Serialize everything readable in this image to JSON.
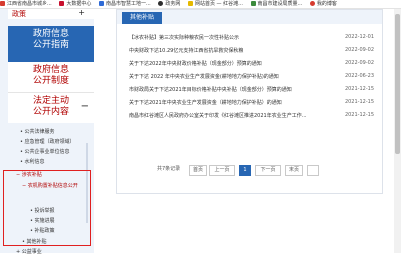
{
  "bookmarks": [
    {
      "label": "江西省南昌市城乡...",
      "icon": "favicon-icon"
    },
    {
      "label": "大数据中心",
      "icon": "favicon-icon"
    },
    {
      "label": "南昌市智慧工地一...",
      "icon": "favicon-icon"
    },
    {
      "label": "政务网",
      "icon": "favicon-icon"
    },
    {
      "label": "网站首页 — 红谷滩...",
      "icon": "favicon-icon"
    },
    {
      "label": "南昌市建设局质量...",
      "icon": "favicon-icon"
    },
    {
      "label": "我的博客",
      "icon": "favicon-icon"
    }
  ],
  "sidebar": {
    "top_item": "政策",
    "top_toggle": "+",
    "guide": [
      "政府信息",
      "公开指南"
    ],
    "system": [
      "政府信息",
      "公开制度"
    ],
    "law": [
      "法定主动",
      "公开内容"
    ],
    "law_toggle": "−",
    "menu": [
      "公共法律服务",
      "应急管理（政府领域）",
      "公共企事业单位信息",
      "水利信息"
    ],
    "subsidy": "涉农补贴",
    "subsidy_children": [
      "农机购置补贴信息公开",
      "投诉举报",
      "实施进展",
      "补贴政策"
    ],
    "other_subsidy": "其他补贴",
    "last_item": "公益事业"
  },
  "content": {
    "tab": "其他补贴",
    "rows": [
      {
        "title": "【冰农补贴】第三次实际种粮农民一次性补贴公示",
        "date": "2022-12-01"
      },
      {
        "title": "中央财政下达10.29亿元支持江西省抗旱救灾保秋粮",
        "date": "2022-09-02"
      },
      {
        "title": "关于下达2022年中央财政价格补贴（现金部分）预算的通知",
        "date": "2022-09-02"
      },
      {
        "title": "关于下达 2022 年中央农业生产发展资金(耕地地力保护补贴)的通知",
        "date": "2022-06-23"
      },
      {
        "title": "市财政局关于下达2021年目标价格补贴中央补贴（现金部分）预算的通知",
        "date": "2021-12-15"
      },
      {
        "title": "关于下达2021年中央农业生产发展资金（耕地地力保护补贴）的通知",
        "date": "2021-12-15"
      },
      {
        "title": "南昌市红谷滩区人民政府办公室关于印发《红谷滩区推进2021年农业生产工作...",
        "date": "2021-12-15"
      }
    ],
    "pager": {
      "total": "共7条记录",
      "first": "首页",
      "prev": "上一页",
      "current": "1",
      "next": "下一页",
      "last": "末页"
    }
  }
}
